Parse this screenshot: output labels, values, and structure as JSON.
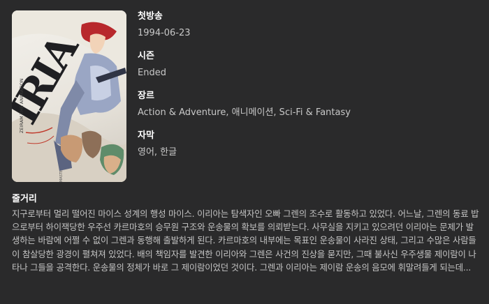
{
  "details": {
    "first_air": {
      "label": "첫방송",
      "value": "1994-06-23"
    },
    "season": {
      "label": "시즌",
      "value": "Ended"
    },
    "genre": {
      "label": "장르",
      "value": "Action & Adventure, 애니메이션, Sci-Fi & Fantasy"
    },
    "subtitles": {
      "label": "자막",
      "value": "영어, 한글"
    }
  },
  "poster": {
    "title_text": "IRIA",
    "subtitle_text": "ZEIRAM THE ANIMATION",
    "collection_text": "MASTER COLLECTION"
  },
  "synopsis": {
    "label": "줄거리",
    "text": "지구로부터 멀리 떨어진 마이스 성계의 행성 마이스. 이리아는 탐색자인 오빠 그렌의 조수로 활동하고 있었다. 어느날, 그렌의 동료 밥으로부터 하이잭당한 우주선 카르마호의 승무원 구조와 운송물의 확보를 의뢰받는다. 사무실을 지키고 있으려던 이리아는 문제가 발생하는 바람에 어쩔 수 없이 그렌과 동행해 출발하게 된다. 카르마호의 내부에는 목표인 운송물이 사라진 상태, 그리고 수많은 사람들이 참살당한 광경이 펼쳐져 있었다. 배의 책임자를 발견한 이리아와 그렌은 사건의 진상을 묻지만, 그때 불사신 우주생물 제이람이 나타나 그들을 공격한다. 운송물의 정체가 바로 그 제이람이었던 것이다. 그렌과 이리아는 제이람 운송의 음모에 휘말려들게 되는데..."
  }
}
